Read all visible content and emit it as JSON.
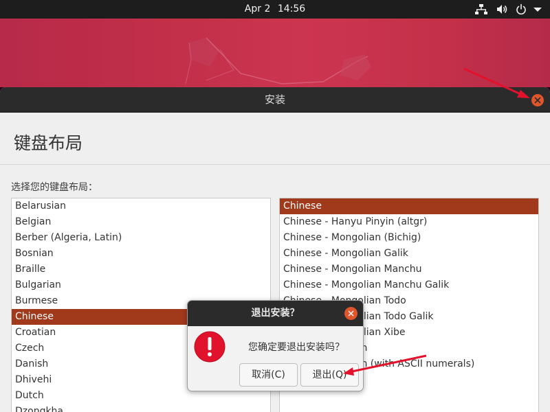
{
  "topbar": {
    "date": "Apr 2",
    "time": "14:56",
    "icons": [
      "network-icon",
      "volume-icon",
      "power-icon",
      "chevron-down-icon"
    ]
  },
  "window": {
    "title": "安装",
    "close_icon": "close-icon"
  },
  "page": {
    "title": "键盘布局",
    "prompt": "选择您的键盘布局："
  },
  "layouts": {
    "items": [
      "Belarusian",
      "Belgian",
      "Berber (Algeria, Latin)",
      "Bosnian",
      "Braille",
      "Bulgarian",
      "Burmese",
      "Chinese",
      "Croatian",
      "Czech",
      "Danish",
      "Dhivehi",
      "Dutch",
      "Dzongkha"
    ],
    "selected": "Chinese"
  },
  "variants": {
    "items": [
      "Chinese",
      "Chinese - Hanyu Pinyin (altgr)",
      "Chinese - Mongolian (Bichig)",
      "Chinese - Mongolian Galik",
      "Chinese - Mongolian Manchu",
      "Chinese - Mongolian Manchu Galik",
      "Chinese - Mongolian Todo",
      "Chinese - Mongolian Todo Galik",
      "Chinese - Mongolian Xibe",
      "Chinese - Tibetan",
      "Chinese - Tibetan (with ASCII numerals)"
    ],
    "selected": "Chinese"
  },
  "dialog": {
    "title": "退出安装？",
    "message": "您确定要退出安装吗？",
    "cancel_label": "取消(C)",
    "quit_label": "退出(Q)",
    "icon": "warning-icon"
  },
  "colors": {
    "accent": "#a1391b",
    "close_button": "#e0562c",
    "annotation_arrow": "#e3122c"
  }
}
